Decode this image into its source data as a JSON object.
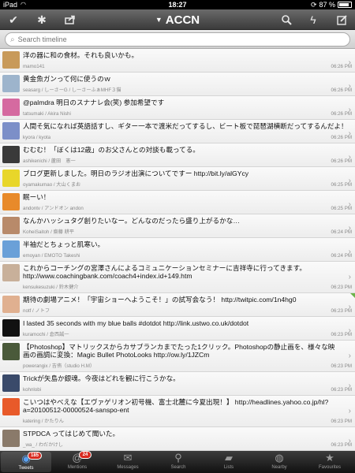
{
  "status_bar": {
    "carrier": "iPad",
    "time": "18:27",
    "battery": "87 %",
    "battery_level": 0.87
  },
  "toolbar": {
    "title": "ACCN"
  },
  "search": {
    "placeholder": "Search timeline",
    "value": ""
  },
  "tweets": [
    {
      "text": "洋の器に和の食材。それも良いかも。",
      "name": "mamo141",
      "time": "06:26 PM",
      "avatar": "#c89a5a"
    },
    {
      "text": "黄金魚ガンって何に使うのｗ",
      "name": "seasarg / しーさーG / しーさーふぁMHF３猫",
      "time": "06:26 PM",
      "avatar": "#9db4cc"
    },
    {
      "text": "@palmdra 明日のスナナレ会(笑) 参加希望です",
      "name": "tatsumaki / Akira Nishi",
      "time": "06:26 PM",
      "avatar": "#d56aa0"
    },
    {
      "text": "人間そ気になれば英語話すし、ギター一本で渡米だってするし、ビート板で琵琶湖横断だってするんだよ！",
      "name": "kyora / kyota",
      "time": "06:26 PM",
      "avatar": "#7c8fc8"
    },
    {
      "text": "むむむ！「ぼくは12歳」のお父さんとの対談も載ってる。",
      "name": "ashikenichi / 蘆田　憲一",
      "time": "06:26 PM",
      "avatar": "#3a3a3a"
    },
    {
      "text": "ブログ更新しました。明日のラジオ出演についてですー http://bit.ly/alGYcy",
      "name": "oyamakumao / 大山くまお",
      "time": "06:25 PM",
      "avatar": "#e8d62a"
    },
    {
      "text": "眠ーい！",
      "name": "andontv / アンドオン andon",
      "time": "06:25 PM",
      "avatar": "#e88a2a"
    },
    {
      "text": "なんかハッシュタグ創りたいなー。どんなのだったら盛り上がるかな…",
      "name": "KoheiSaitoh / 齋藤 耕平",
      "time": "06:24 PM",
      "avatar": "#b88a6a"
    },
    {
      "text": "半袖だとちょっと肌寒い。",
      "name": "emoyan / EMOTO Takeshi",
      "time": "06:24 PM",
      "avatar": "#6aa0d8"
    },
    {
      "text": "これからコーチングの宮澤さんによるコミュニケーションセミナーに吉祥寺に行ってきます。http://www.coachingbank.com/coach4+index.id+149.htm",
      "name": "kensukesuzuki / 鈴木健介",
      "time": "06:23 PM",
      "avatar": "#c8b09a",
      "tall": true
    },
    {
      "text": "期待の劇場アニメ！「宇宙ショーへようこそ！」の試写会なう！ http://twitpic.com/1n4hg0",
      "name": "notf / ノトフ",
      "time": "06:23 PM",
      "avatar": "#e0b090",
      "flag": true
    },
    {
      "text": "I lasted 35 seconds with my blue balls #dotdot http://link.ustwo.co.uk/dotdot",
      "name": "kuramochi / 倉西誠一",
      "time": "06:23 PM",
      "avatar": "#111111"
    },
    {
      "text": "【Photoshop】マトリックスからカサブランカまでたった1クリック。Photoshopの静止画を、様々な映画の画調に変換：Magic Bullet PhotoLooks http://ow.ly/1JZCm",
      "name": "powerangix / 吉侑（studio H.M）",
      "time": "06:23 PM",
      "avatar": "#4a5a3a",
      "tall": true
    },
    {
      "text": "Trickが矢島か銀魂。今夜はどれを観に行こうかな。",
      "name": "kohnlobi",
      "time": "06:23 PM",
      "avatar": "#3a4a6a"
    },
    {
      "text": "こいつはやべえな【エヴァゲリオン初号機、富士北麓に今夏出現！】 http://headlines.yahoo.co.jp/hl?a=20100512-00000524-sanspo-ent",
      "name": "katering / かたりん",
      "time": "06:23 PM",
      "avatar": "#e85a2a",
      "tall": true
    },
    {
      "text": "STPDCA ってはじめて聞いた。",
      "name": "_wa_ / わだかけし",
      "time": "06:23 PM",
      "avatar": "#8a7a6a"
    }
  ],
  "tabs": [
    {
      "label": "Tweets",
      "icon": "tweets-icon",
      "badge": "185",
      "active": true
    },
    {
      "label": "Mentions",
      "icon": "at-icon",
      "badge": "24"
    },
    {
      "label": "Messages",
      "icon": "envelope-icon"
    },
    {
      "label": "Search",
      "icon": "search-icon"
    },
    {
      "label": "Lists",
      "icon": "folder-icon"
    },
    {
      "label": "Nearby",
      "icon": "globe-icon"
    },
    {
      "label": "Favourites",
      "icon": "star-icon"
    }
  ]
}
